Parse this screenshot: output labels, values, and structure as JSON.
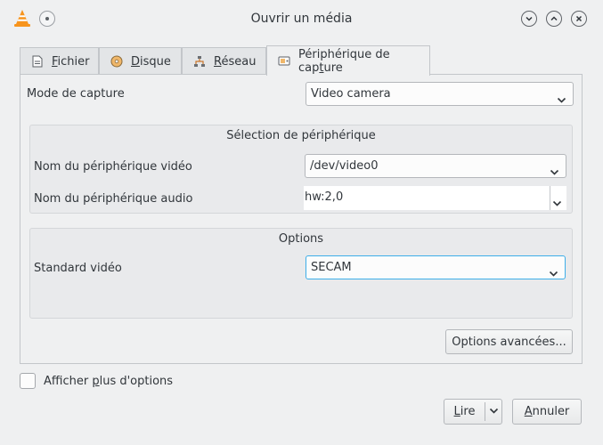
{
  "window": {
    "title": "Ouvrir un média"
  },
  "tabs": [
    {
      "prefix": "",
      "mnemonic": "F",
      "rest": "ichier"
    },
    {
      "prefix": "",
      "mnemonic": "D",
      "rest": "isque"
    },
    {
      "prefix": "",
      "mnemonic": "R",
      "rest": "éseau"
    },
    {
      "prefix": "Périphérique de cap",
      "mnemonic": "t",
      "rest": "ure"
    }
  ],
  "capture": {
    "mode_label": "Mode de capture",
    "mode_value": "Video camera"
  },
  "device_selection": {
    "title": "Sélection de périphérique",
    "video_label": "Nom du périphérique vidéo",
    "video_value": "/dev/video0",
    "audio_label": "Nom du périphérique audio",
    "audio_value": "hw:2,0"
  },
  "options": {
    "title": "Options",
    "standard_label": "Standard vidéo",
    "standard_value": "SECAM",
    "advanced_button": "Options avancées..."
  },
  "more_options": {
    "prefix": "Afficher ",
    "mnemonic": "p",
    "rest": "lus d'options"
  },
  "buttons": {
    "play_mnemonic": "L",
    "play_rest": "ire",
    "cancel_mnemonic": "A",
    "cancel_rest": "nnuler"
  },
  "colors": {
    "accent": "#3daee9",
    "vlc_orange": "#f7941d"
  }
}
